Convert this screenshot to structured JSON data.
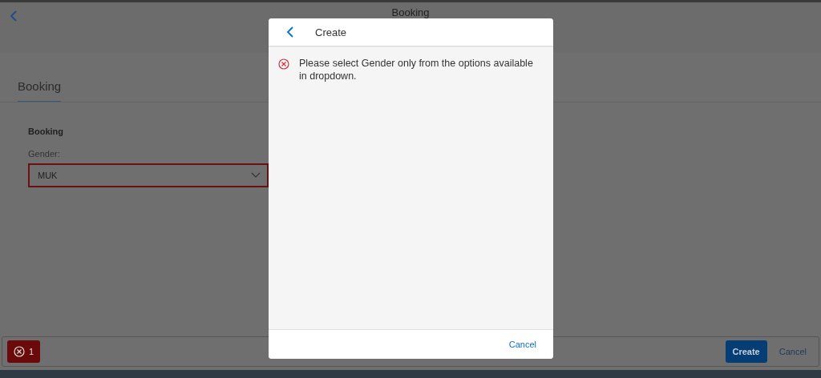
{
  "page": {
    "title": "Booking",
    "tabs": [
      {
        "label": "Booking",
        "selected": true
      }
    ],
    "section_title": "Booking",
    "field": {
      "label": "Gender:",
      "value": "MUK",
      "error": true
    }
  },
  "footer": {
    "message_count": "1",
    "buttons": [
      {
        "label": "Create",
        "kind": "primary"
      },
      {
        "label": "Cancel",
        "kind": "plain"
      }
    ]
  },
  "dialog": {
    "title": "Create",
    "messages": [
      {
        "kind": "error",
        "text": "Please select Gender only from the options available in dropdown."
      }
    ],
    "buttons": [
      {
        "label": "Cancel",
        "kind": "plain"
      }
    ]
  }
}
